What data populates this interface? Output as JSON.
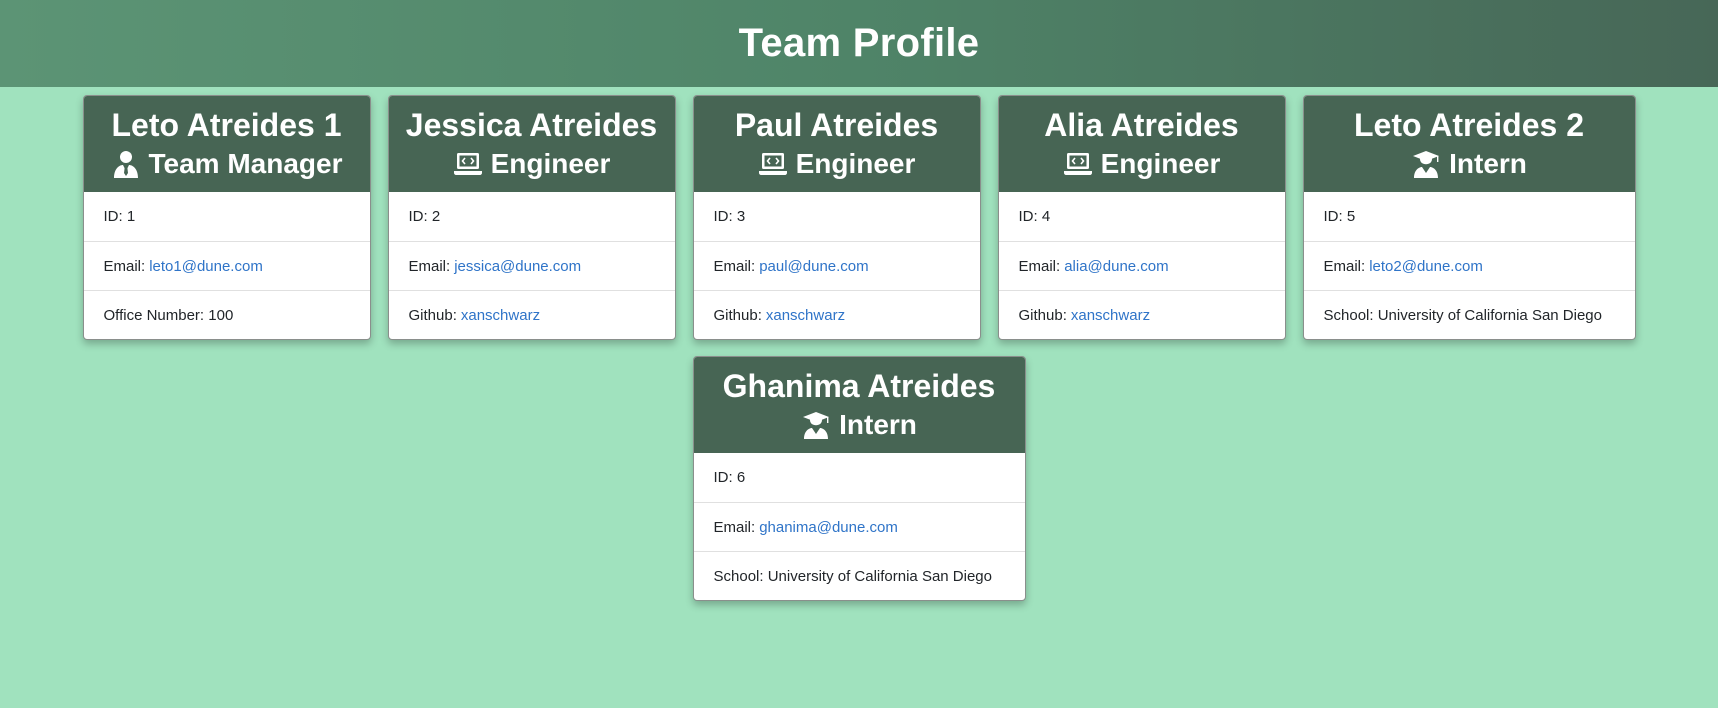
{
  "page": {
    "title": "Team Profile"
  },
  "colors": {
    "background": "#a0e2be",
    "header": "#4f8468",
    "card_header": "#476554",
    "link": "#2f74c8"
  },
  "labels": {
    "id": "ID:",
    "email": "Email:",
    "office": "Office Number:",
    "github": "Github:",
    "school": "School:"
  },
  "team": [
    {
      "name": "Leto Atreides 1",
      "role": "Team Manager",
      "icon": "user-tie-icon",
      "id": "1",
      "email": "leto1@dune.com",
      "extra_type": "office",
      "extra": "100"
    },
    {
      "name": "Jessica Atreides",
      "role": "Engineer",
      "icon": "laptop-code-icon",
      "id": "2",
      "email": "jessica@dune.com",
      "extra_type": "github",
      "extra": "xanschwarz"
    },
    {
      "name": "Paul Atreides",
      "role": "Engineer",
      "icon": "laptop-code-icon",
      "id": "3",
      "email": "paul@dune.com",
      "extra_type": "github",
      "extra": "xanschwarz"
    },
    {
      "name": "Alia Atreides",
      "role": "Engineer",
      "icon": "laptop-code-icon",
      "id": "4",
      "email": "alia@dune.com",
      "extra_type": "github",
      "extra": "xanschwarz"
    },
    {
      "name": "Leto Atreides 2",
      "role": "Intern",
      "icon": "user-graduate-icon",
      "id": "5",
      "email": "leto2@dune.com",
      "extra_type": "school",
      "extra": "University of California San Diego"
    },
    {
      "name": "Ghanima Atreides",
      "role": "Intern",
      "icon": "user-graduate-icon",
      "id": "6",
      "email": "ghanima@dune.com",
      "extra_type": "school",
      "extra": "University of California San Diego"
    }
  ]
}
